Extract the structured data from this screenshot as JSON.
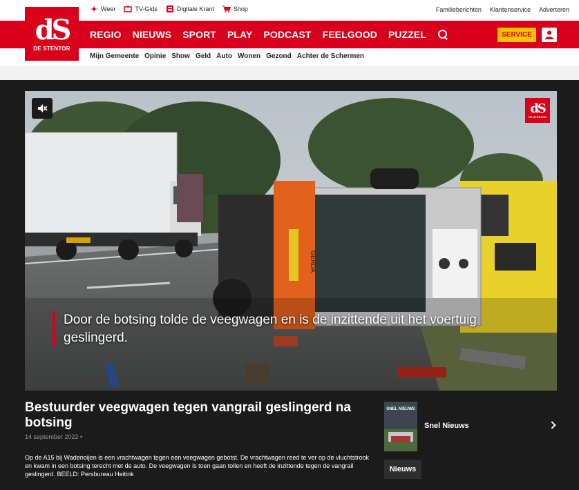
{
  "brand": {
    "logo_text": "dS",
    "logo_subtext": "DE STENTOR",
    "color": "#d9001b",
    "accent": "#f7c200"
  },
  "utility_left": [
    {
      "label": "Weer",
      "icon": "weather-icon"
    },
    {
      "label": "TV-Gids",
      "icon": "tv-icon"
    },
    {
      "label": "Digitale Krant",
      "icon": "newspaper-icon"
    },
    {
      "label": "Shop",
      "icon": "cart-icon"
    }
  ],
  "utility_right": [
    "Familieberichten",
    "Klantenservice",
    "Adverteren"
  ],
  "main_nav": [
    "REGIO",
    "NIEUWS",
    "SPORT",
    "PLAY",
    "PODCAST",
    "FEELGOOD",
    "PUZZEL"
  ],
  "service_label": "SERVICE",
  "sub_nav": [
    "Mijn Gemeente",
    "Opinie",
    "Show",
    "Geld",
    "Auto",
    "Wonen",
    "Gezond",
    "Achter de Schermen"
  ],
  "hero": {
    "caption": "Door de botsing tolde de veegwagen en is de inzittende uit het voertuig geslingerd.",
    "logo_text": "dS",
    "logo_subtext": "DE STENTOR",
    "vehicle_text": "GERDA"
  },
  "article": {
    "title": "Bestuurder veegwagen tegen vangrail geslingerd na botsing",
    "date": "14 september 2022 •",
    "description": "Op de A15 bij Wadenoijen is een vrachtwagen tegen een veegwagen gebotst. De vrachtwagen reed te ver op de vluchtstrook en kwam in een botsing terecht met de auto. De veegwagen is toen gaan tollen en heeft de inzittende tegen de vangrail geslingerd. BEELD: Persbureau Heitink"
  },
  "sidebar": {
    "thumb_label": "SNEL NIEUWS",
    "playlist_title": "Snel Nieuws",
    "tag": "Nieuws"
  }
}
